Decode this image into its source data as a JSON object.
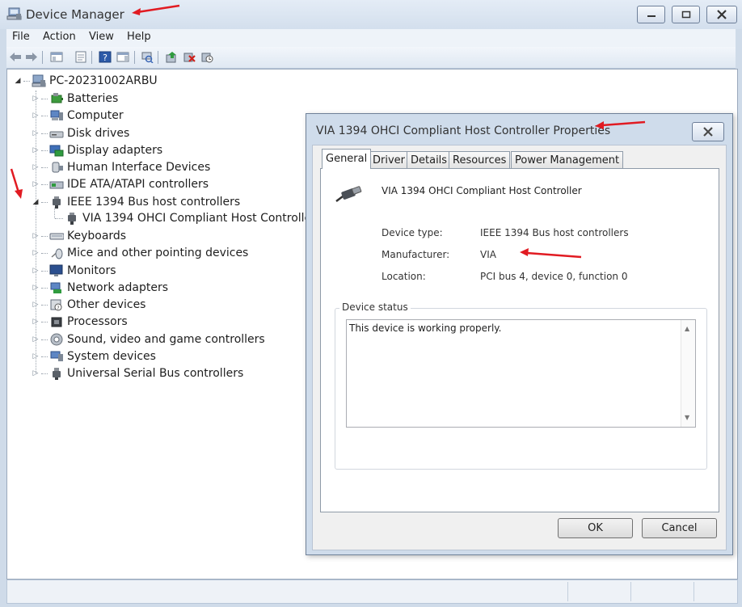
{
  "window": {
    "title": "Device Manager",
    "title_icon": "device-manager-icon",
    "controls": [
      "minimize",
      "maximize",
      "close"
    ]
  },
  "menu": {
    "items": [
      "File",
      "Action",
      "View",
      "Help"
    ]
  },
  "toolbar": {
    "icons": [
      "back-arrow-icon",
      "forward-arrow-icon",
      "show-hide-console-tree-icon",
      "properties-icon",
      "help-icon",
      "show-action-pane-icon",
      "scan-hardware-icon",
      "update-driver-icon",
      "uninstall-device-icon",
      "disable-device-icon"
    ]
  },
  "tree": {
    "root": "PC-20231002ARBU",
    "categories": [
      {
        "label": "Batteries",
        "icon": "battery-icon"
      },
      {
        "label": "Computer",
        "icon": "computer-icon"
      },
      {
        "label": "Disk drives",
        "icon": "disk-drive-icon"
      },
      {
        "label": "Display adapters",
        "icon": "display-adapter-icon"
      },
      {
        "label": "Human Interface Devices",
        "icon": "hid-icon"
      },
      {
        "label": "IDE ATA/ATAPI controllers",
        "icon": "ide-controller-icon"
      },
      {
        "label": "IEEE 1394 Bus host controllers",
        "icon": "firewire-icon",
        "expanded": true
      },
      {
        "label": "Keyboards",
        "icon": "keyboard-icon"
      },
      {
        "label": "Mice and other pointing devices",
        "icon": "mouse-icon"
      },
      {
        "label": "Monitors",
        "icon": "monitor-icon"
      },
      {
        "label": "Network adapters",
        "icon": "network-adapter-icon"
      },
      {
        "label": "Other devices",
        "icon": "other-devices-icon"
      },
      {
        "label": "Processors",
        "icon": "processor-icon"
      },
      {
        "label": "Sound, video and game controllers",
        "icon": "sound-icon"
      },
      {
        "label": "System devices",
        "icon": "system-devices-icon"
      },
      {
        "label": "Universal Serial Bus controllers",
        "icon": "usb-icon"
      }
    ],
    "child_of_ieee": "VIA 1394 OHCI Compliant Host Controller"
  },
  "dialog": {
    "title": "VIA 1394 OHCI Compliant Host Controller Properties",
    "tabs": [
      "General",
      "Driver",
      "Details",
      "Resources",
      "Power Management"
    ],
    "active_tab": "General",
    "device_name": "VIA 1394 OHCI Compliant Host Controller",
    "properties": {
      "device_type_label": "Device type:",
      "device_type_value": "IEEE 1394 Bus host controllers",
      "manufacturer_label": "Manufacturer:",
      "manufacturer_value": "VIA",
      "location_label": "Location:",
      "location_value": "PCI bus 4, device 0, function 0"
    },
    "status_group_label": "Device status",
    "status_text": "This device is working properly.",
    "ok_label": "OK",
    "cancel_label": "Cancel"
  },
  "colors": {
    "annotation_arrow": "#e11b22",
    "window_frame": "#cfdbe9",
    "accent_blue": "#3a66b5"
  }
}
